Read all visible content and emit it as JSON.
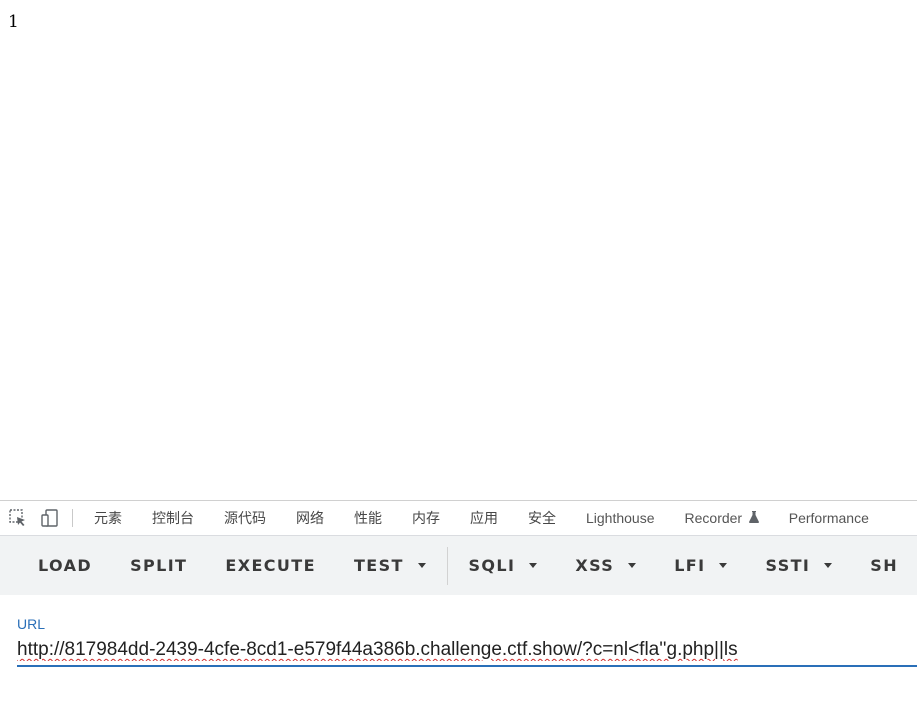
{
  "page": {
    "output": "1"
  },
  "devtools": {
    "icons": [
      "inspect-element-icon",
      "device-toolbar-icon"
    ],
    "tabs": [
      {
        "label": "元素"
      },
      {
        "label": "控制台"
      },
      {
        "label": "源代码"
      },
      {
        "label": "网络"
      },
      {
        "label": "性能"
      },
      {
        "label": "内存"
      },
      {
        "label": "应用"
      },
      {
        "label": "安全"
      },
      {
        "label": "Lighthouse"
      },
      {
        "label": "Recorder"
      },
      {
        "label": "Performance"
      }
    ]
  },
  "hackbar": {
    "buttons": {
      "load": "LOAD",
      "split": "SPLIT",
      "execute": "EXECUTE",
      "test": "TEST",
      "sqli": "SQLI",
      "xss": "XSS",
      "lfi": "LFI",
      "ssti": "SSTI",
      "shell": "SH"
    },
    "url_label": "URL",
    "url_value": "http://817984dd-2439-4cfe-8cd1-e579f44a386b.challenge.ctf.show/?c=nl<fla''g.php||ls"
  },
  "colors": {
    "accent": "#2a6fb8",
    "toolbar_bg": "#f1f3f4"
  }
}
